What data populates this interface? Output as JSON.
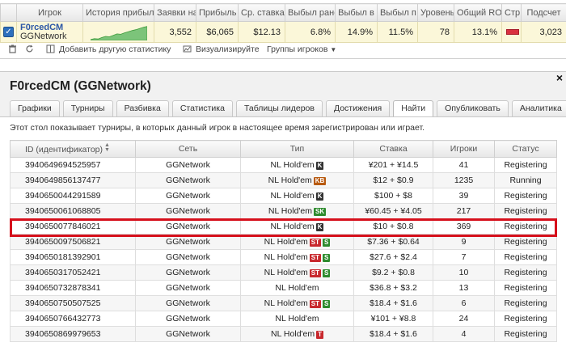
{
  "stats": {
    "headers": [
      "Игрок",
      "История прибыли",
      "Заявки на",
      "Прибыль",
      "Ср. ставка",
      "Выбыл ранее",
      "Выбыл в",
      "Выбыл п",
      "Уровень",
      "Общий ROI",
      "Стр",
      "Подсчет"
    ],
    "row": {
      "checked": true,
      "player_name": "F0rcedCM",
      "player_network": "GGNetwork",
      "entries": "3,552",
      "profit": "$6,065",
      "avg_stake": "$12.13",
      "early": "6.8%",
      "mid": "14.9%",
      "late": "11.5%",
      "level": "78",
      "roi": "13.1%",
      "count": "3,023"
    },
    "sparkline": [
      0.06,
      0.12,
      0.1,
      0.2,
      0.28,
      0.25,
      0.35,
      0.45,
      0.42,
      0.52,
      0.6,
      0.68,
      0.74,
      0.82,
      0.9,
      0.96
    ],
    "flag_color": "#d93040"
  },
  "toolbar": {
    "add_stat": "Добавить другую статистику",
    "visualize": "Визуализируйте",
    "groups": "Группы игроков"
  },
  "panel": {
    "title": "F0rcedCM (GGNetwork)",
    "close": "×",
    "tabs": [
      "Графики",
      "Турниры",
      "Разбивка",
      "Статистика",
      "Таблицы лидеров",
      "Достижения",
      "Найти",
      "Опубликовать",
      "Аналитика"
    ],
    "active_tab": 6,
    "description": "Этот стол показывает турниры, в которых данный игрок в настоящее время зарегистрирован или играет.",
    "columns": [
      "ID (идентификатор)",
      "Сеть",
      "Тип",
      "Ставка",
      "Игроки",
      "Статус"
    ],
    "rows": [
      {
        "id": "3940649694525957",
        "network": "GGNetwork",
        "type": "NL Hold'em",
        "badges": [
          {
            "text": "K",
            "color": "#333333"
          }
        ],
        "stake": "¥201 + ¥14.5",
        "players": "41",
        "status": "Registering"
      },
      {
        "id": "3940649856137477",
        "network": "GGNetwork",
        "type": "NL Hold'em",
        "badges": [
          {
            "text": "KB",
            "color": "#b85a10"
          }
        ],
        "stake": "$12 + $0.9",
        "players": "1235",
        "status": "Running"
      },
      {
        "id": "3940650044291589",
        "network": "GGNetwork",
        "type": "NL Hold'em",
        "badges": [
          {
            "text": "K",
            "color": "#333333"
          }
        ],
        "stake": "$100 + $8",
        "players": "39",
        "status": "Registering"
      },
      {
        "id": "3940650061068805",
        "network": "GGNetwork",
        "type": "NL Hold'em",
        "badges": [
          {
            "text": "SK",
            "color": "#2e8b2e"
          }
        ],
        "stake": "¥60.45 + ¥4.05",
        "players": "217",
        "status": "Registering"
      },
      {
        "id": "3940650077846021",
        "network": "GGNetwork",
        "type": "NL Hold'em",
        "badges": [
          {
            "text": "K",
            "color": "#333333"
          }
        ],
        "stake": "$10 + $0.8",
        "players": "369",
        "status": "Registering"
      },
      {
        "id": "3940650097506821",
        "network": "GGNetwork",
        "type": "NL Hold'em",
        "badges": [
          {
            "text": "ST",
            "color": "#c8282d"
          },
          {
            "text": "S",
            "color": "#2e8b2e"
          }
        ],
        "stake": "$7.36 + $0.64",
        "players": "9",
        "status": "Registering"
      },
      {
        "id": "3940650181392901",
        "network": "GGNetwork",
        "type": "NL Hold'em",
        "badges": [
          {
            "text": "ST",
            "color": "#c8282d"
          },
          {
            "text": "S",
            "color": "#2e8b2e"
          }
        ],
        "stake": "$27.6 + $2.4",
        "players": "7",
        "status": "Registering"
      },
      {
        "id": "3940650317052421",
        "network": "GGNetwork",
        "type": "NL Hold'em",
        "badges": [
          {
            "text": "ST",
            "color": "#c8282d"
          },
          {
            "text": "S",
            "color": "#2e8b2e"
          }
        ],
        "stake": "$9.2 + $0.8",
        "players": "10",
        "status": "Registering"
      },
      {
        "id": "3940650732878341",
        "network": "GGNetwork",
        "type": "NL Hold'em",
        "badges": [],
        "stake": "$36.8 + $3.2",
        "players": "13",
        "status": "Registering"
      },
      {
        "id": "3940650750507525",
        "network": "GGNetwork",
        "type": "NL Hold'em",
        "badges": [
          {
            "text": "ST",
            "color": "#c8282d"
          },
          {
            "text": "S",
            "color": "#2e8b2e"
          }
        ],
        "stake": "$18.4 + $1.6",
        "players": "6",
        "status": "Registering"
      },
      {
        "id": "3940650766432773",
        "network": "GGNetwork",
        "type": "NL Hold'em",
        "badges": [],
        "stake": "¥101 + ¥8.8",
        "players": "24",
        "status": "Registering"
      },
      {
        "id": "3940650869979653",
        "network": "GGNetwork",
        "type": "NL Hold'em",
        "badges": [
          {
            "text": "T",
            "color": "#c8282d"
          }
        ],
        "stake": "$18.4 + $1.6",
        "players": "4",
        "status": "Registering"
      }
    ],
    "highlighted_row": 4,
    "highlight_color": "#d6101c"
  }
}
